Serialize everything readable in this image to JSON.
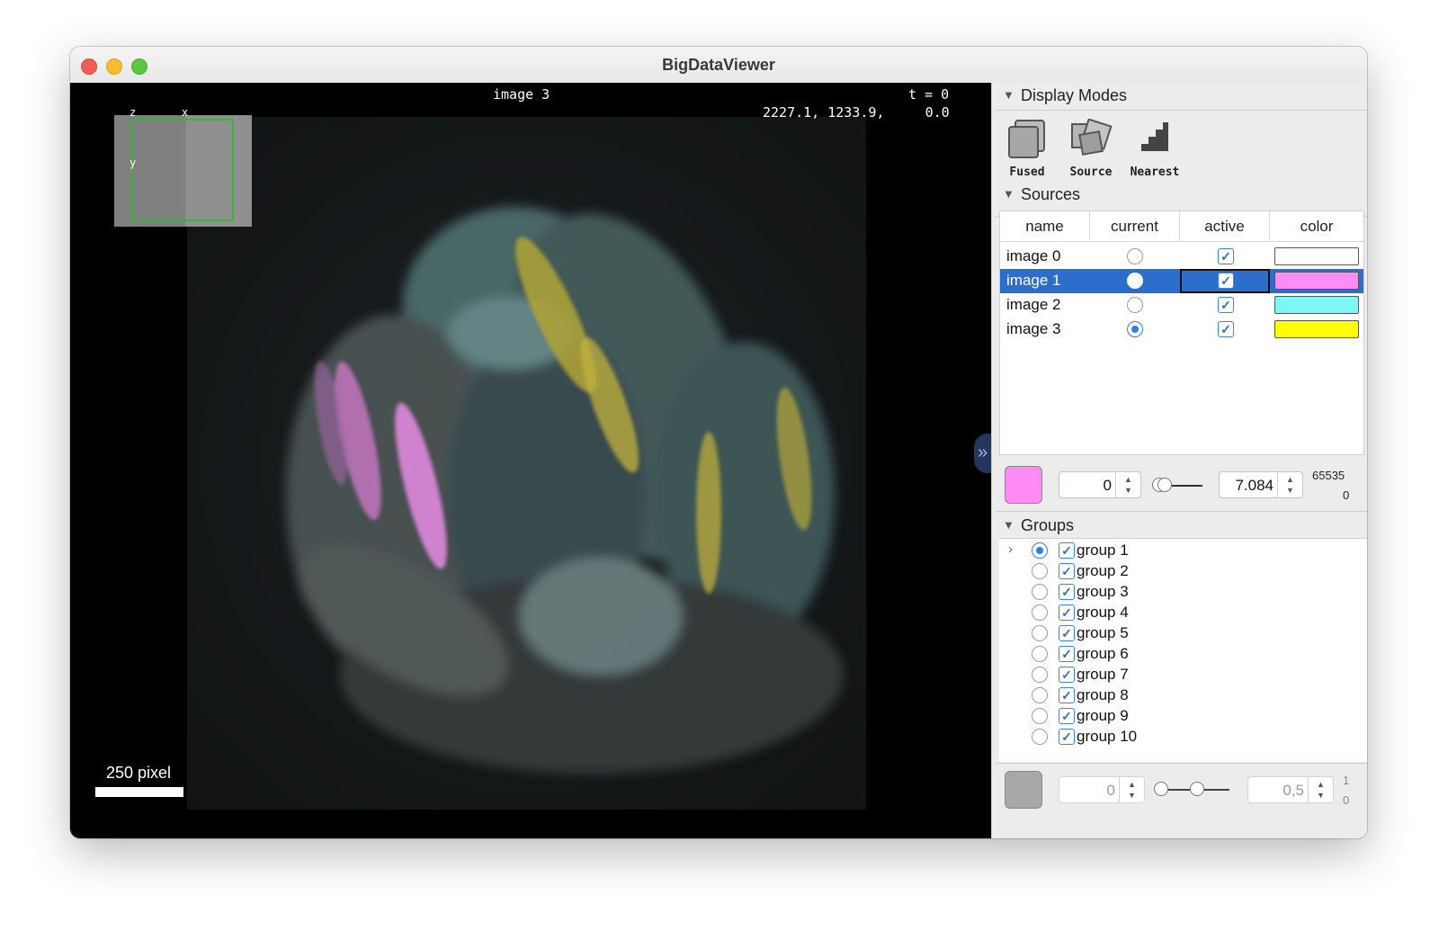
{
  "window": {
    "title": "BigDataViewer"
  },
  "viewer": {
    "source_name": "image 3",
    "time": "t = 0",
    "coordinates": "2227.1, 1233.9,     0.0",
    "minimap_axes": {
      "z": "z",
      "x": "x",
      "y": "y"
    },
    "scalebar": "250 pixel",
    "collapse_icon": "chevron-right-icon"
  },
  "display_modes": {
    "header": "Display Modes",
    "modes": [
      {
        "label": "Fused",
        "icon": "fused-icon"
      },
      {
        "label": "Source",
        "icon": "source-icon"
      },
      {
        "label": "Nearest",
        "icon": "nearest-icon"
      }
    ]
  },
  "sources": {
    "header": "Sources",
    "columns": [
      "name",
      "current",
      "active",
      "color"
    ],
    "rows": [
      {
        "name": "image 0",
        "current": false,
        "active": true,
        "color": "#ffffff",
        "selected": false
      },
      {
        "name": "image 1",
        "current": false,
        "active": true,
        "color": "#ff8cf4",
        "selected": true
      },
      {
        "name": "image 2",
        "current": false,
        "active": true,
        "color": "#7ff6f6",
        "selected": false
      },
      {
        "name": "image 3",
        "current": true,
        "active": true,
        "color": "#ffff00",
        "selected": false
      }
    ],
    "display_range": {
      "swatch_color": "#ff8cf4",
      "min": "0",
      "max": "7.084",
      "range_max": "65535",
      "range_min": "0"
    }
  },
  "groups": {
    "header": "Groups",
    "items": [
      {
        "name": "group 1",
        "current": true,
        "active": true
      },
      {
        "name": "group 2",
        "current": false,
        "active": true
      },
      {
        "name": "group 3",
        "current": false,
        "active": true
      },
      {
        "name": "group 4",
        "current": false,
        "active": true
      },
      {
        "name": "group 5",
        "current": false,
        "active": true
      },
      {
        "name": "group 6",
        "current": false,
        "active": true
      },
      {
        "name": "group 7",
        "current": false,
        "active": true
      },
      {
        "name": "group 8",
        "current": false,
        "active": true
      },
      {
        "name": "group 9",
        "current": false,
        "active": true
      },
      {
        "name": "group 10",
        "current": false,
        "active": true
      }
    ],
    "display_range": {
      "swatch_color": "#a8a8a8",
      "min": "0",
      "max": "0,5",
      "range_max": "1",
      "range_min": "0"
    }
  }
}
